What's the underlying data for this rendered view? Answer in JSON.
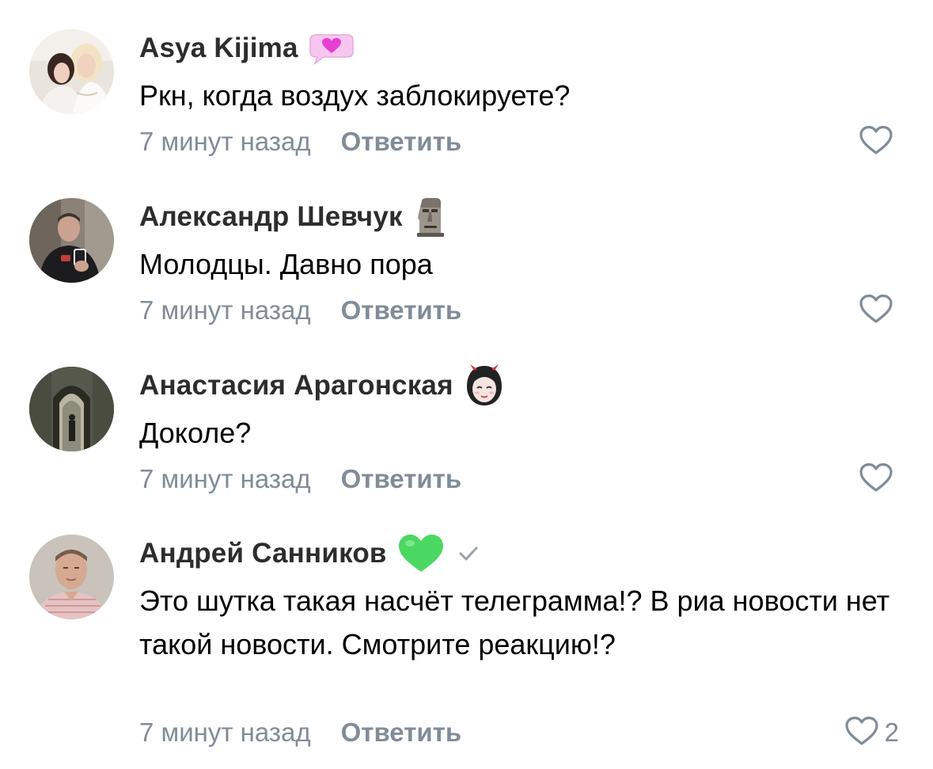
{
  "comments": [
    {
      "author": "Asya Kijima",
      "badge": "pink-heart-speech-bubble-icon",
      "text": "Ркн, когда воздух заблокируете?",
      "time": "7 минут назад",
      "reply_label": "Ответить",
      "likes": ""
    },
    {
      "author": "Александр Шевчук",
      "badge": "moai-icon",
      "text": "Молодцы. Давно пора",
      "time": "7 минут назад",
      "reply_label": "Ответить",
      "likes": ""
    },
    {
      "author": "Анастасия Арагонская",
      "badge": "anime-devil-girl-sticker-icon",
      "text": "Доколе?",
      "time": "7 минут назад",
      "reply_label": "Ответить",
      "likes": ""
    },
    {
      "author": "Андрей Санников",
      "badge": "green-heart-icon",
      "verified": true,
      "text": "Это шутка такая насчёт телеграмма!? В риа новости нет такой новости. Смотрите реакцию!?",
      "time": "7 минут назад",
      "reply_label": "Ответить",
      "likes": "2"
    }
  ],
  "colors": {
    "author": "#2c2d2e",
    "text": "#000000",
    "secondary": "#818c99",
    "green_heart": "#4bd862",
    "pink_badge": "#f7c6f0",
    "pink_heart": "#e83fd3"
  }
}
